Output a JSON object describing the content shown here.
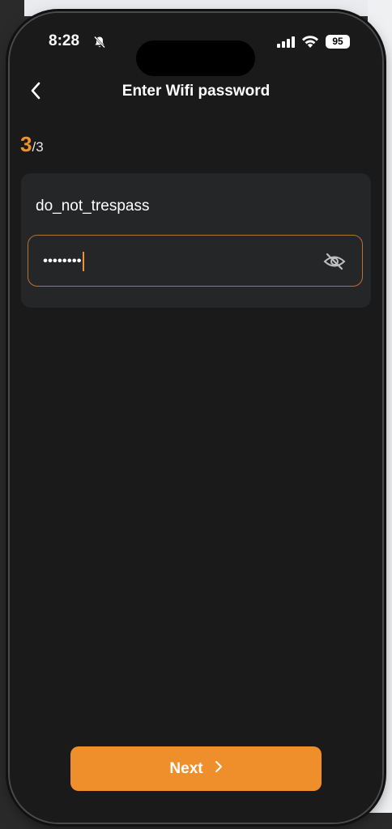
{
  "status_bar": {
    "time": "8:28",
    "battery": "95"
  },
  "nav": {
    "title": "Enter Wifi password"
  },
  "step": {
    "current": "3",
    "separator": "/3"
  },
  "network": {
    "ssid": "do_not_trespass"
  },
  "password_field": {
    "value": "••••••••"
  },
  "actions": {
    "next_label": "Next"
  },
  "colors": {
    "accent": "#EF8F2B",
    "background": "#1A1A1A",
    "card": "#242628"
  },
  "icons": [
    "chevron-left-icon",
    "bell-slash-icon",
    "signal-icon",
    "wifi-icon",
    "eye-slash-icon",
    "chevron-right-icon"
  ]
}
